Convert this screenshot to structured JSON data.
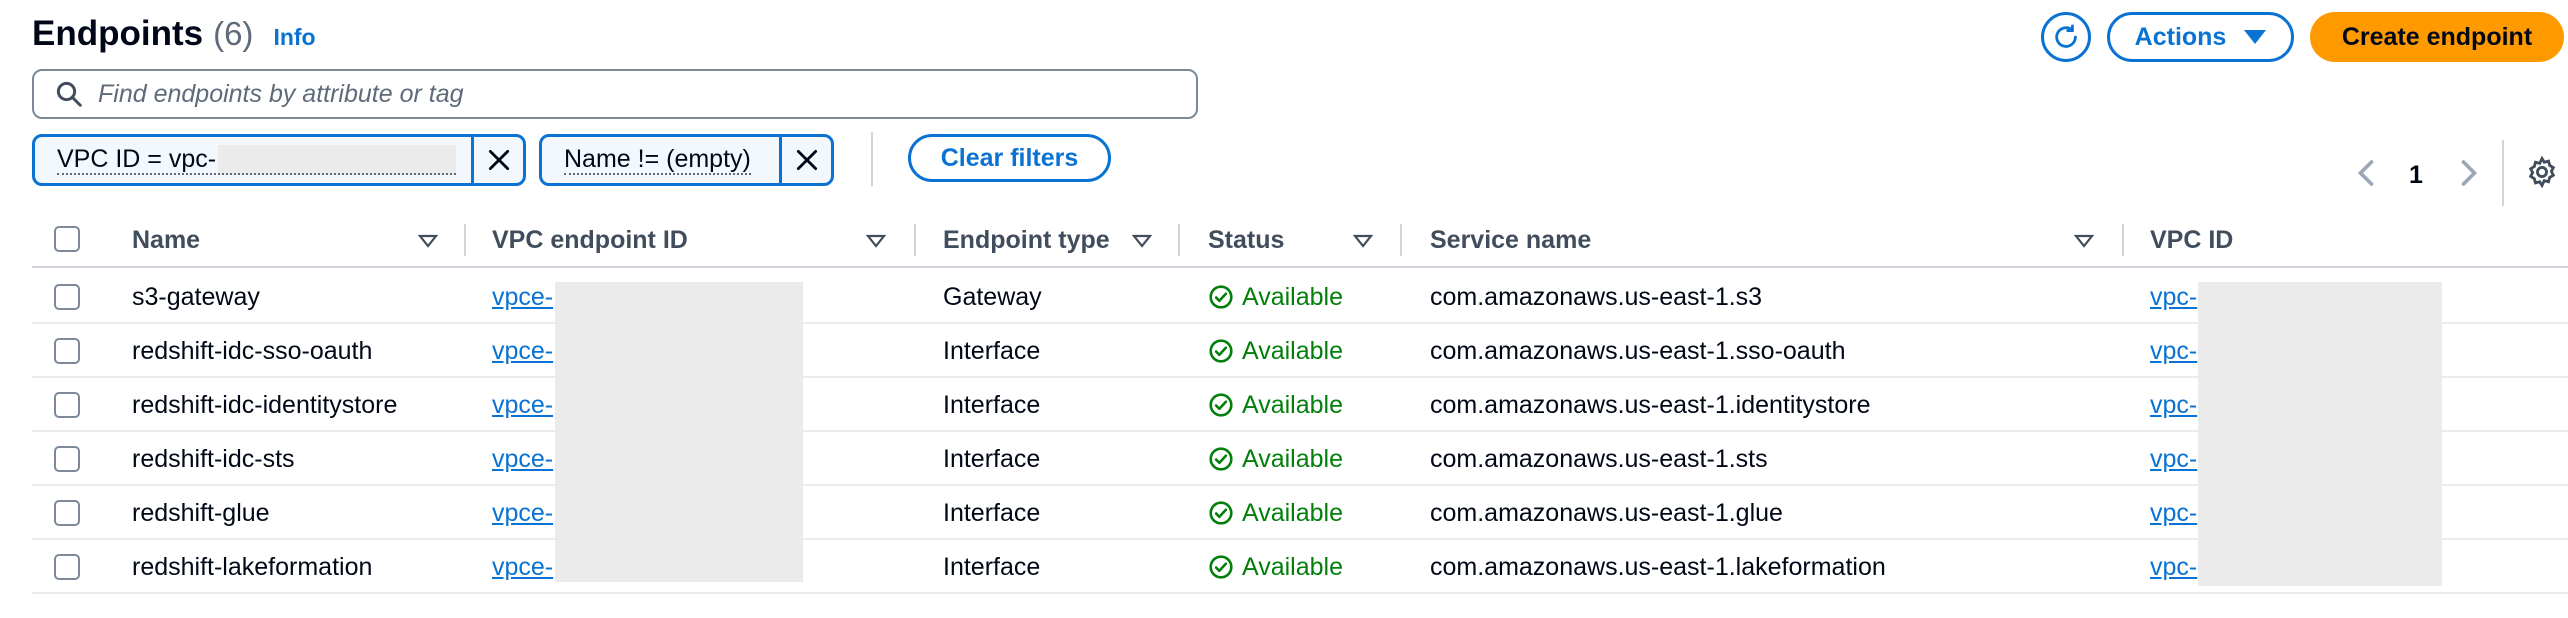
{
  "header": {
    "title": "Endpoints",
    "count": "(6)",
    "info": "Info"
  },
  "toolbar": {
    "actions_label": "Actions",
    "create_label": "Create endpoint"
  },
  "search": {
    "placeholder": "Find endpoints by attribute or tag"
  },
  "filters": [
    {
      "label": "VPC ID = vpc-"
    },
    {
      "label": "Name != (empty)"
    }
  ],
  "clear_filters_label": "Clear filters",
  "pagination": {
    "current_page": "1"
  },
  "table": {
    "columns": [
      "Name",
      "VPC endpoint ID",
      "Endpoint type",
      "Status",
      "Service name",
      "VPC ID"
    ],
    "rows": [
      {
        "name": "s3-gateway",
        "endpoint_id": "vpce-",
        "type": "Gateway",
        "status": "Available",
        "service": "com.amazonaws.us-east-1.s3",
        "vpc_id": "vpc-"
      },
      {
        "name": "redshift-idc-sso-oauth",
        "endpoint_id": "vpce-",
        "type": "Interface",
        "status": "Available",
        "service": "com.amazonaws.us-east-1.sso-oauth",
        "vpc_id": "vpc-"
      },
      {
        "name": "redshift-idc-identitystore",
        "endpoint_id": "vpce-",
        "type": "Interface",
        "status": "Available",
        "service": "com.amazonaws.us-east-1.identitystore",
        "vpc_id": "vpc-"
      },
      {
        "name": "redshift-idc-sts",
        "endpoint_id": "vpce-",
        "type": "Interface",
        "status": "Available",
        "service": "com.amazonaws.us-east-1.sts",
        "vpc_id": "vpc-"
      },
      {
        "name": "redshift-glue",
        "endpoint_id": "vpce-",
        "type": "Interface",
        "status": "Available",
        "service": "com.amazonaws.us-east-1.glue",
        "vpc_id": "vpc-"
      },
      {
        "name": "redshift-lakeformation",
        "endpoint_id": "vpce-",
        "type": "Interface",
        "status": "Available",
        "service": "com.amazonaws.us-east-1.lakeformation",
        "vpc_id": "vpc-"
      }
    ]
  },
  "icons": {
    "refresh": "refresh-icon",
    "actions_caret": "caret-down-icon",
    "search": "search-icon",
    "filter_close": "close-icon",
    "prev": "chevron-left-icon",
    "next": "chevron-right-icon",
    "settings": "gear-icon",
    "sort": "sort-caret-icon",
    "status": "check-circle-icon"
  },
  "colors": {
    "accent": "#0972d3",
    "primary_button": "#ff9900",
    "status_success": "#037f0c"
  }
}
